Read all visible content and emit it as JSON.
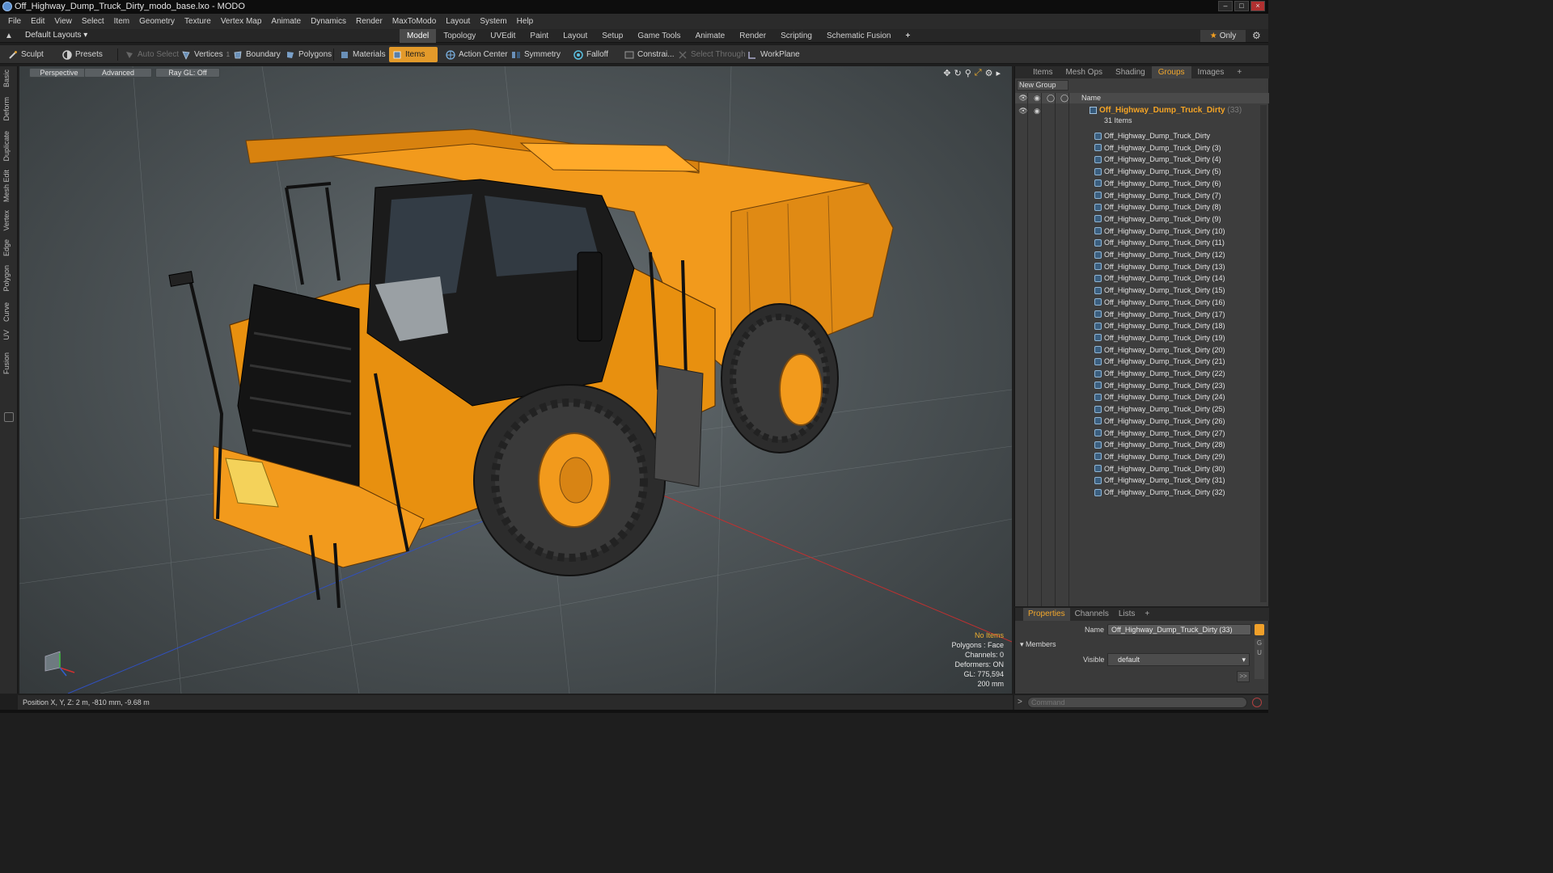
{
  "window": {
    "title": "Off_Highway_Dump_Truck_Dirty_modo_base.lxo - MODO",
    "controls": [
      "–",
      "□",
      "×"
    ]
  },
  "menubar": [
    "File",
    "Edit",
    "View",
    "Select",
    "Item",
    "Geometry",
    "Texture",
    "Vertex Map",
    "Animate",
    "Dynamics",
    "Render",
    "MaxToModo",
    "Layout",
    "System",
    "Help"
  ],
  "layoutbar": {
    "default_layouts": "Default Layouts ▾",
    "tabs": [
      "Model",
      "Topology",
      "UVEdit",
      "Paint",
      "Layout",
      "Setup",
      "Game Tools",
      "Animate",
      "Render",
      "Scripting",
      "Schematic Fusion",
      "+"
    ],
    "active_tab": "Model",
    "only_label": "Only"
  },
  "toolbar": {
    "sculpt": "Sculpt",
    "presets": "Presets",
    "auto_select": "Auto Select",
    "vertices": "Vertices",
    "vertices_count": "1",
    "boundary": "Boundary",
    "polygons": "Polygons",
    "materials": "Materials",
    "items": "Items",
    "action_center": "Action Center",
    "symmetry": "Symmetry",
    "falloff": "Falloff",
    "constraint": "Constrai...",
    "select_through": "Select Through",
    "workplane": "WorkPlane"
  },
  "left_tabs": [
    "Basic",
    "Deform",
    "Duplicate",
    "Mesh Edit",
    "Vertex",
    "Edge",
    "Polygon",
    "Curve",
    "UV",
    "Fusion"
  ],
  "viewport": {
    "view_mode": "Perspective",
    "shading": "Advanced",
    "raygl": "Ray GL: Off",
    "stats": {
      "no_items": "No Items",
      "polygons": "Polygons : Face",
      "channels": "Channels: 0",
      "deformers": "Deformers: ON",
      "gl": "GL: 775,594",
      "scale": "200 mm"
    },
    "model_colors": {
      "body": "#f29a1c",
      "dark": "#1c1c1c",
      "tire": "#333333"
    }
  },
  "statusbar": {
    "position": "Position X, Y, Z:  2 m, -810 mm, -9.68 m"
  },
  "right_panel": {
    "tabs": [
      "Items",
      "Mesh Ops",
      "Shading",
      "Groups",
      "Images",
      "+"
    ],
    "active_tab": "Groups",
    "new_group": "New Group",
    "col_name": "Name",
    "group": {
      "name": "Off_Highway_Dump_Truck_Dirty",
      "count": "(33)",
      "sub": "31 Items"
    },
    "items": [
      "Off_Highway_Dump_Truck_Dirty",
      "Off_Highway_Dump_Truck_Dirty (3)",
      "Off_Highway_Dump_Truck_Dirty (4)",
      "Off_Highway_Dump_Truck_Dirty (5)",
      "Off_Highway_Dump_Truck_Dirty (6)",
      "Off_Highway_Dump_Truck_Dirty (7)",
      "Off_Highway_Dump_Truck_Dirty (8)",
      "Off_Highway_Dump_Truck_Dirty (9)",
      "Off_Highway_Dump_Truck_Dirty (10)",
      "Off_Highway_Dump_Truck_Dirty (11)",
      "Off_Highway_Dump_Truck_Dirty (12)",
      "Off_Highway_Dump_Truck_Dirty (13)",
      "Off_Highway_Dump_Truck_Dirty (14)",
      "Off_Highway_Dump_Truck_Dirty (15)",
      "Off_Highway_Dump_Truck_Dirty (16)",
      "Off_Highway_Dump_Truck_Dirty (17)",
      "Off_Highway_Dump_Truck_Dirty (18)",
      "Off_Highway_Dump_Truck_Dirty (19)",
      "Off_Highway_Dump_Truck_Dirty (20)",
      "Off_Highway_Dump_Truck_Dirty (21)",
      "Off_Highway_Dump_Truck_Dirty (22)",
      "Off_Highway_Dump_Truck_Dirty (23)",
      "Off_Highway_Dump_Truck_Dirty (24)",
      "Off_Highway_Dump_Truck_Dirty (25)",
      "Off_Highway_Dump_Truck_Dirty (26)",
      "Off_Highway_Dump_Truck_Dirty (27)",
      "Off_Highway_Dump_Truck_Dirty (28)",
      "Off_Highway_Dump_Truck_Dirty (29)",
      "Off_Highway_Dump_Truck_Dirty (30)",
      "Off_Highway_Dump_Truck_Dirty (31)",
      "Off_Highway_Dump_Truck_Dirty (32)"
    ]
  },
  "properties": {
    "tabs": [
      "Properties",
      "Channels",
      "Lists",
      "+"
    ],
    "active_tab": "Properties",
    "name_label": "Name",
    "name_value": "Off_Highway_Dump_Truck_Dirty (33)",
    "members_label": "Members",
    "visible_label": "Visible",
    "visible_value": "default",
    "more": ">>",
    "side_letters": "G\nU"
  },
  "command": {
    "placeholder": "Command",
    "prompt": ">"
  },
  "accent": "#f29a1c"
}
